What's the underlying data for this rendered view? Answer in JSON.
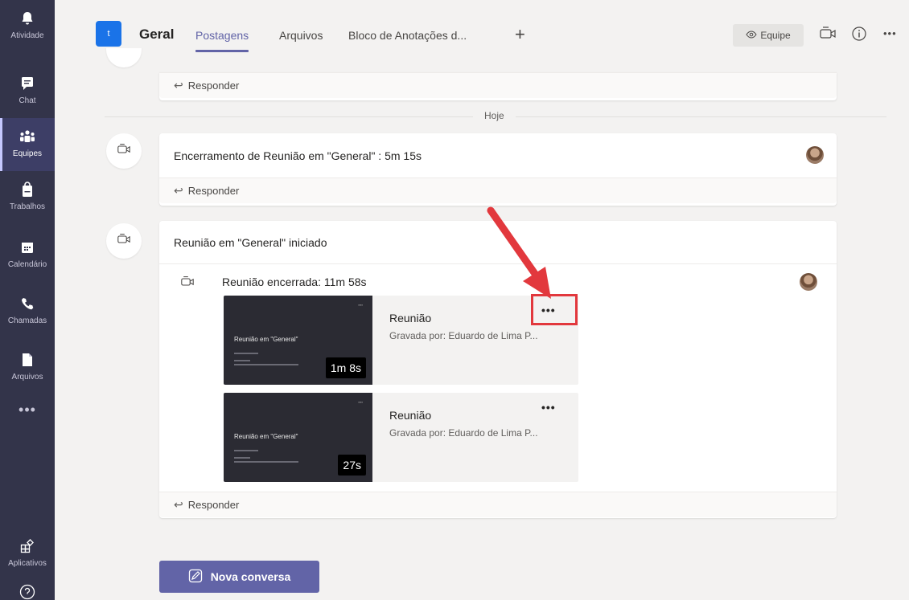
{
  "rail": {
    "items": [
      {
        "label": "Atividade",
        "icon": "bell-icon"
      },
      {
        "label": "Chat",
        "icon": "chat-icon"
      },
      {
        "label": "Equipes",
        "icon": "teams-icon"
      },
      {
        "label": "Trabalhos",
        "icon": "assignments-icon"
      },
      {
        "label": "Calendário",
        "icon": "calendar-icon"
      },
      {
        "label": "Chamadas",
        "icon": "phone-icon"
      },
      {
        "label": "Arquivos",
        "icon": "file-icon"
      }
    ],
    "more": "•••",
    "apps": {
      "label": "Aplicativos",
      "icon": "apps-icon"
    },
    "help_icon": "help-icon",
    "active": "Equipes"
  },
  "header": {
    "team_avatar": "t",
    "channel": "Geral",
    "tabs": [
      "Postagens",
      "Arquivos",
      "Bloco de Anotações d..."
    ],
    "add_tab": "+",
    "team_button": "Equipe",
    "more": "•••"
  },
  "feed": {
    "prev_reply": "Responder",
    "divider": "Hoje",
    "posts": [
      {
        "title": "Encerramento de Reunião em \"General\" : 5m 15s",
        "reply": "Responder"
      },
      {
        "title": "Reunião em \"General\" iniciado",
        "sub": "Reunião encerrada: 11m 58s",
        "recordings": [
          {
            "title": "Reunião",
            "by": "Gravada por: Eduardo de Lima P...",
            "duration": "1m 8s",
            "thumb_title": "Reunião em \"General\"",
            "more": "•••"
          },
          {
            "title": "Reunião",
            "by": "Gravada por: Eduardo de Lima P...",
            "duration": "27s",
            "thumb_title": "Reunião em \"General\"",
            "more": "•••"
          }
        ],
        "reply": "Responder"
      }
    ]
  },
  "new_conversation": "Nova conversa",
  "colors": {
    "rail": "#33344a",
    "accent": "#6264a7",
    "highlight": "#e2383d"
  }
}
